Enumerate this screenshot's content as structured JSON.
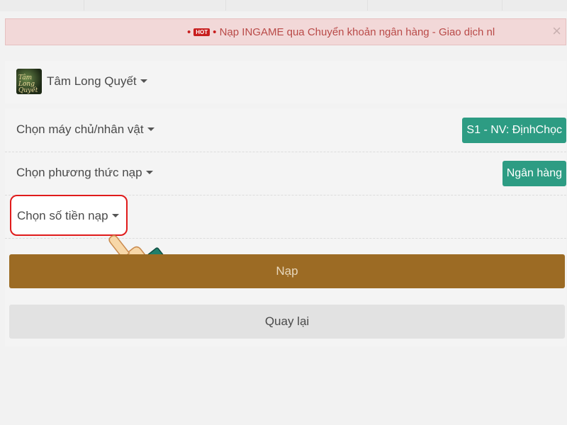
{
  "notice": {
    "hot_badge": "HOT",
    "text": "Nạp INGAME qua Chuyển khoản ngân hàng - Giao dịch nl",
    "close_glyph": "×"
  },
  "game": {
    "logo_text": "Tâm Long Quyết",
    "name": "Tâm Long Quyết"
  },
  "form": {
    "server_label": "Chọn máy chủ/nhân vật",
    "server_value": "S1 - NV: ĐịnhChọc",
    "method_label": "Chọn phương thức nạp",
    "method_value": "Ngân hàng",
    "amount_label": "Chọn số tiền nạp"
  },
  "buttons": {
    "submit": "Nạp",
    "back": "Quay lại"
  },
  "colors": {
    "accent_teal": "#2d9c83",
    "submit_brown": "#9c6b24",
    "highlight_red": "#e01b1b",
    "notice_bg": "#f2d8d8"
  },
  "icons": {
    "caret": "caret-down-icon",
    "pointer": "pointing-hand-icon",
    "close": "close-icon"
  }
}
